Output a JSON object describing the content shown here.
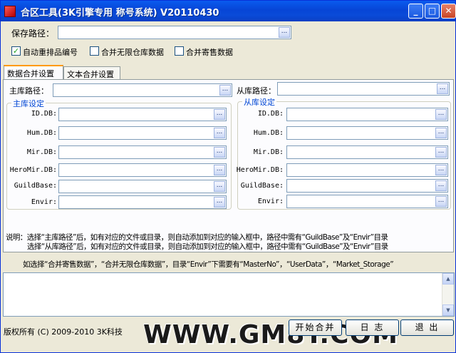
{
  "window": {
    "title": "合区工具(3K引擎专用 称号系统) V20110430",
    "controls": {
      "minimize": "_",
      "maximize": "□",
      "close": "✕"
    }
  },
  "save_path": {
    "label": "保存路径：",
    "value": ""
  },
  "checkboxes": [
    {
      "label": "自动重排品编号",
      "checked": true
    },
    {
      "label": "合并无限仓库数据",
      "checked": false
    },
    {
      "label": "合并寄售数据",
      "checked": false
    }
  ],
  "tabs": [
    {
      "label": "数据合并设置",
      "active": true
    },
    {
      "label": "文本合并设置",
      "active": false
    }
  ],
  "main": {
    "path_label": "主库路径：",
    "group_title": "主库设定",
    "fields": [
      {
        "label": "ID.DB:"
      },
      {
        "label": "Hum.DB:"
      },
      {
        "label": "Mir.DB:"
      },
      {
        "label": "HeroMir.DB:"
      },
      {
        "label": "GuildBase:"
      },
      {
        "label": "Envir:"
      }
    ]
  },
  "slave": {
    "path_label": "从库路径：",
    "group_title": "从库设定",
    "fields": [
      {
        "label": "ID.DB:"
      },
      {
        "label": "Hum.DB:"
      },
      {
        "label": "Mir.DB:"
      },
      {
        "label": "HeroMir.DB:"
      },
      {
        "label": "GuildBase:"
      },
      {
        "label": "Envir:"
      }
    ]
  },
  "notes": {
    "line1": "说明：选择“主库路径”后，如有对应的文件或目录，则自动添加到对应的输入框中，路径中需有“GuildBase”及“Envir”目录",
    "line2": "选择“从库路径”后，如有对应的文件或目录，则自动添加到对应的输入框中，路径中需有“GuildBase”及“Envir”目录",
    "line3": "如选择“合并寄售数据”，“合并无限仓库数据”，目录“Envir”下需要有“MasterNo”，“UserData”，“Market_Storage”"
  },
  "footer": {
    "copyright": "版权所有 (C) 2009-2010 3K科技"
  },
  "buttons": {
    "start": "开始合并",
    "log": "日 志",
    "exit": "退 出"
  },
  "watermark": "WWW.GM8T.COM",
  "browse_icon": "..."
}
